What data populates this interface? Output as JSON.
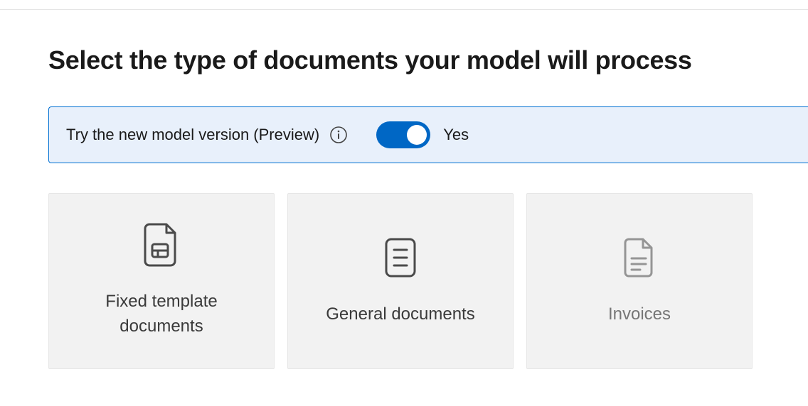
{
  "page": {
    "title": "Select the type of documents your model will process"
  },
  "preview_banner": {
    "label": "Try the new model version (Preview)",
    "toggle_on": true,
    "toggle_state_label": "Yes"
  },
  "cards": [
    {
      "id": "fixed-template",
      "label": "Fixed template documents",
      "icon": "fixed-template-doc-icon"
    },
    {
      "id": "general-documents",
      "label": "General documents",
      "icon": "general-doc-icon"
    },
    {
      "id": "invoices",
      "label": "Invoices",
      "icon": "invoice-doc-icon"
    }
  ]
}
